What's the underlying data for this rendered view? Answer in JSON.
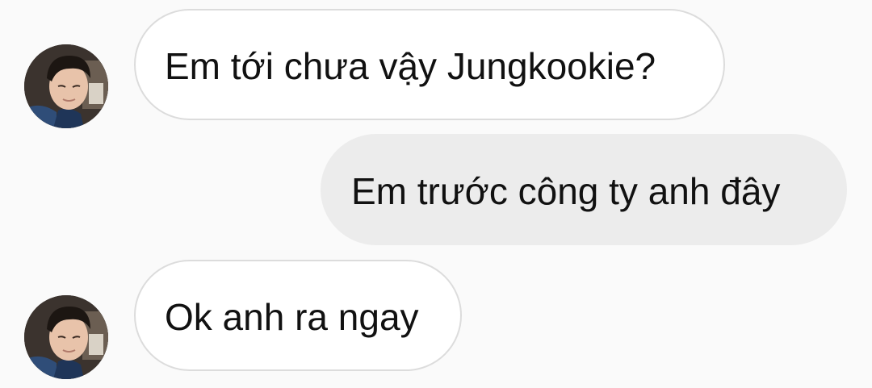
{
  "conversation": {
    "messages": [
      {
        "sender": "other",
        "text": "Em tới chưa vậy Jungkookie?",
        "avatar_icon": "profile-photo"
      },
      {
        "sender": "self",
        "text": "Em trước công ty anh đây"
      },
      {
        "sender": "other",
        "text": "Ok anh ra ngay",
        "avatar_icon": "profile-photo"
      }
    ]
  },
  "colors": {
    "background": "#fafafa",
    "incoming_bubble": "#ffffff",
    "incoming_border": "#dcdcdc",
    "outgoing_bubble": "#ececec",
    "text": "#111111"
  }
}
